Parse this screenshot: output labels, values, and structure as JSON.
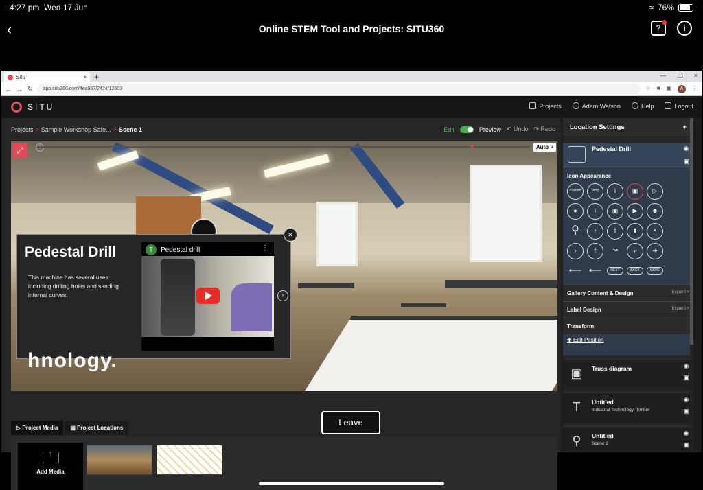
{
  "ios": {
    "time": "4:27 pm",
    "date": "Wed 17 Jun",
    "battery": "76%"
  },
  "app_header": {
    "title": "Online STEM Tool and Projects: SITU360"
  },
  "browser": {
    "tab_title": "Situ",
    "url": "app.situ360.com/4ea957/2424/12503",
    "avatar": "A"
  },
  "situ": {
    "brand": "SITU",
    "nav": {
      "projects": "Projects",
      "user": "Adam Watson",
      "help": "Help",
      "logout": "Logout"
    },
    "breadcrumb": {
      "root": "Projects",
      "project": "Sample Workshop Safe...",
      "current": "Scene 1"
    },
    "mode": {
      "edit": "Edit",
      "preview": "Preview",
      "undo": "Undo",
      "redo": "Redo"
    },
    "quality": "Auto",
    "timeline_progress": 0.88
  },
  "popup": {
    "title": "Pedestal Drill",
    "description": "This machine has several uses including drilling holes and sanding internal curves.",
    "video_channel_initial": "T",
    "video_title": "Pedestal drill"
  },
  "scene_text_overlay": "hnology.",
  "media": {
    "tabs": [
      "Project Media",
      "Project Locations"
    ],
    "add_media": "Add Media",
    "leave": "Leave"
  },
  "panel": {
    "title": "Location Settings",
    "active_location": "Pedestal Drill",
    "icon_appearance": "Icon Appearance",
    "gallery": "Gallery Content & Design",
    "label": "Label Design",
    "expand": "Expand",
    "transform": "Transform",
    "edit_position": "Edit Position",
    "icon_pill_labels": [
      "NEXT",
      "BACK",
      "MORE"
    ],
    "icon_top_labels": [
      "Custom",
      "Temp"
    ],
    "locations": [
      {
        "title": "Truss diagram",
        "subtitle": ""
      },
      {
        "title": "Untitled",
        "subtitle": "Industrial Technology: Timber"
      },
      {
        "title": "Untitled",
        "subtitle": "Scene 2"
      }
    ]
  },
  "colors": {
    "accent": "#e24a5a",
    "edit_green": "#4caf50",
    "panel_active": "#2f3b4a"
  }
}
